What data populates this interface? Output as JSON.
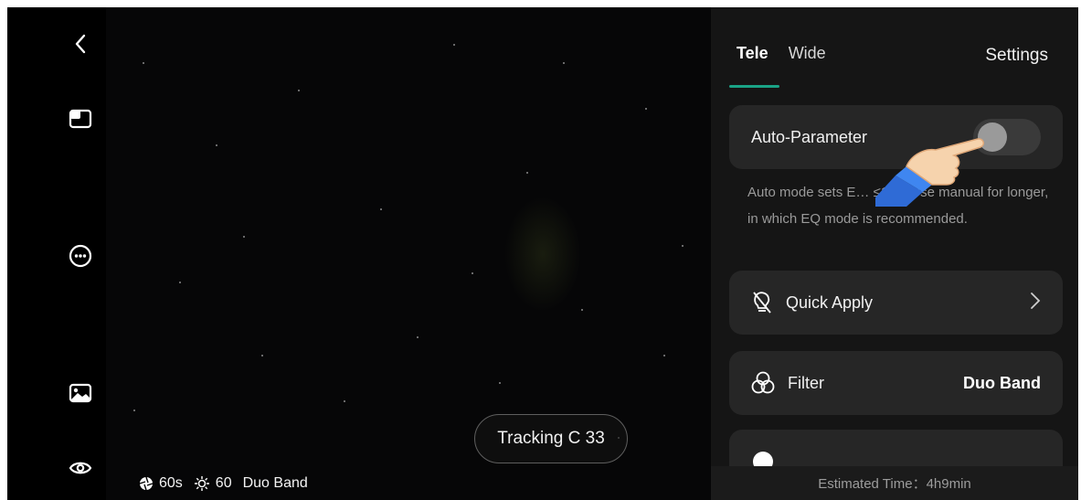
{
  "rail": {
    "icons": [
      "back-chevron-icon",
      "layout-split-icon",
      "more-circle-icon",
      "gallery-image-icon",
      "eye-icon"
    ]
  },
  "viewfinder": {
    "tracking_label": "Tracking C 33",
    "status": {
      "shutter": "60s",
      "gain": "60",
      "filter": "Duo Band"
    }
  },
  "panel": {
    "tabs": [
      {
        "label": "Tele",
        "active": true
      },
      {
        "label": "Wide",
        "active": false
      }
    ],
    "settings_label": "Settings",
    "auto_parameter": {
      "label": "Auto-Parameter",
      "enabled": false
    },
    "note": "Auto mode sets E… ≤15s. Use manual for longer, in which EQ mode is recommended.",
    "quick_apply": {
      "label": "Quick Apply"
    },
    "filter": {
      "label": "Filter",
      "value": "Duo Band"
    },
    "estimated_time": "Estimated Time：4h9min"
  },
  "colors": {
    "accent": "#1aa386",
    "panel_bg": "#151515",
    "card_bg": "#262626"
  }
}
